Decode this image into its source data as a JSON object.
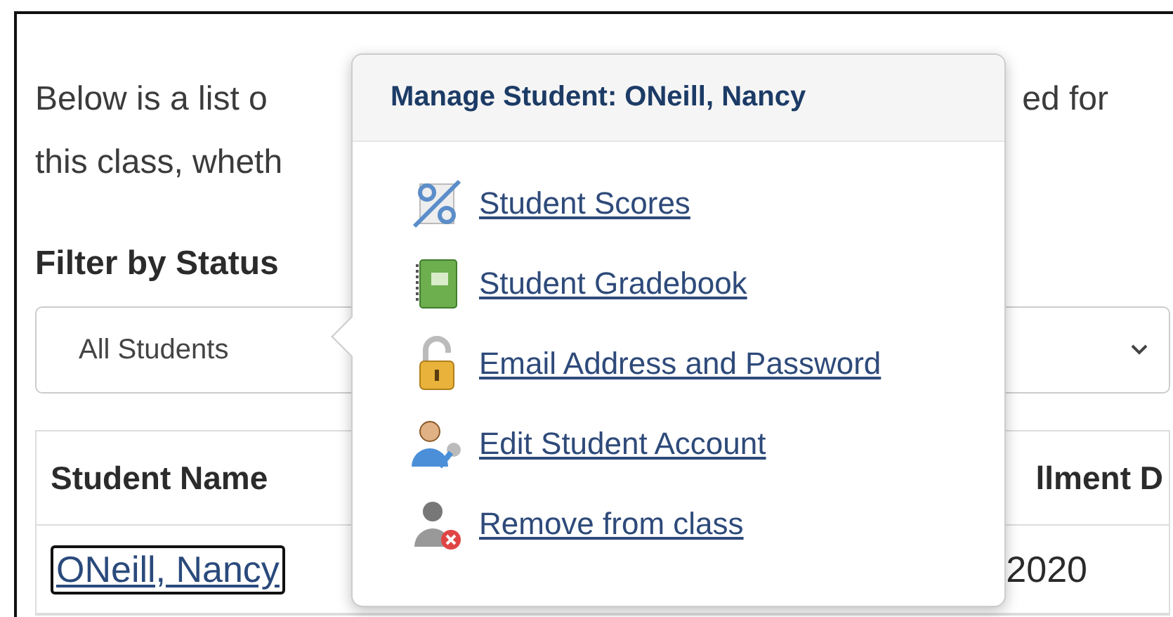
{
  "intro": {
    "lines": [
      {
        "left": "Below is a list o",
        "right": "ed for"
      },
      {
        "left": "this class, wheth"
      }
    ]
  },
  "filter": {
    "label": "Filter by Status",
    "value": "All Students"
  },
  "table": {
    "columns": [
      {
        "left": "Student Name",
        "right": "llment D"
      }
    ],
    "rows": [
      {
        "name": "ONeill, Nancy",
        "date": "2020",
        "focused": true
      }
    ]
  },
  "popover": {
    "title": "Manage Student: ONeill, Nancy",
    "items": [
      {
        "kind": "scores",
        "label": "Student Scores"
      },
      {
        "kind": "gradebook",
        "label": "Student Gradebook"
      },
      {
        "kind": "password",
        "label": "Email Address and Password"
      },
      {
        "kind": "account",
        "label": "Edit Student Account"
      },
      {
        "kind": "remove",
        "label": "Remove from class"
      }
    ]
  }
}
